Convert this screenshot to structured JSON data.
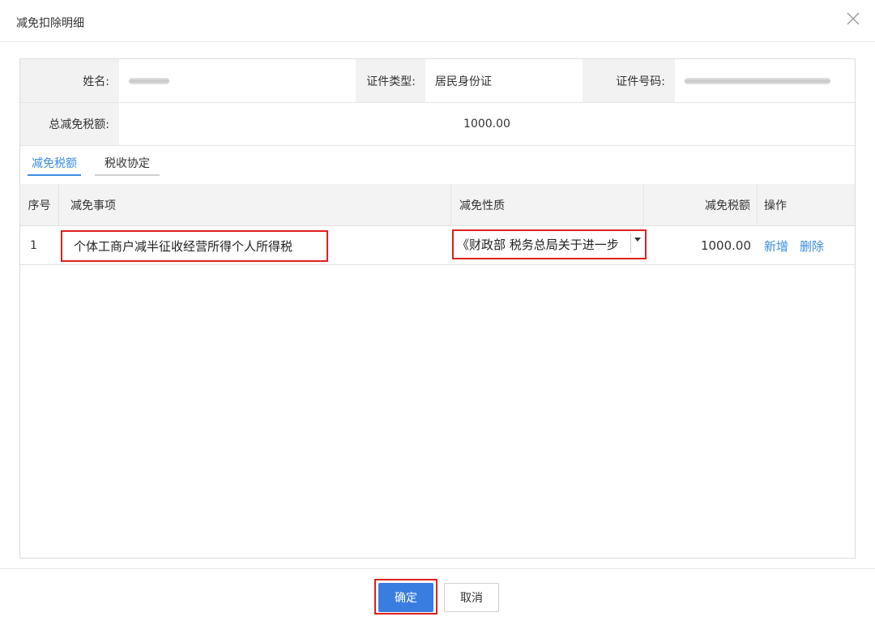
{
  "dialog": {
    "title": "减免扣除明细",
    "close_icon": "close-icon"
  },
  "info": {
    "name_label": "姓名:",
    "id_type_label": "证件类型:",
    "id_type_value": "居民身份证",
    "id_number_label": "证件号码:",
    "total_label": "总减免税额:",
    "total_value": "1000.00"
  },
  "tabs": [
    {
      "label": "减免税额",
      "active": true
    },
    {
      "label": "税收协定",
      "active": false
    }
  ],
  "grid": {
    "headers": {
      "seq": "序号",
      "item": "减免事项",
      "nature": "减免性质",
      "amount": "减免税额",
      "action": "操作"
    },
    "rows": [
      {
        "seq": "1",
        "item": "个体工商户减半征收经营所得个人所得税",
        "nature": "《财政部 税务总局关于进一步",
        "amount": "1000.00",
        "add_label": "新增",
        "delete_label": "删除"
      }
    ]
  },
  "footer": {
    "ok_label": "确定",
    "cancel_label": "取消"
  },
  "colors": {
    "accent": "#3a8ee6",
    "primary_button": "#3a7de0",
    "highlight_border": "#e0201f"
  }
}
